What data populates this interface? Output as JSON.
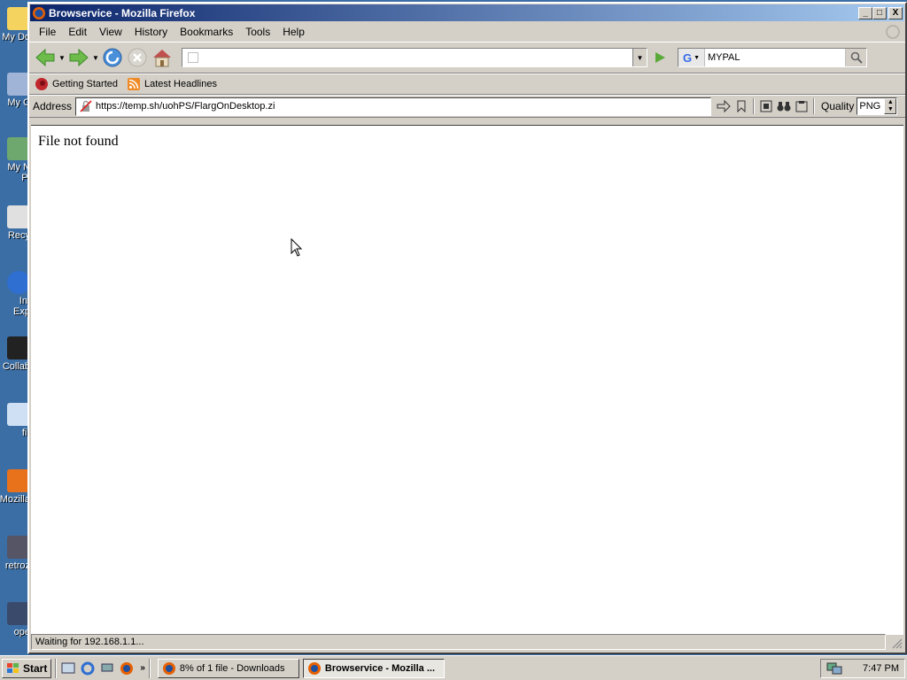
{
  "desktop": {
    "icons": [
      {
        "label": "My Do",
        "name": "my-documents"
      },
      {
        "label": "My C",
        "name": "my-computer"
      },
      {
        "label": "My N\nPl",
        "name": "my-network-places"
      },
      {
        "label": "Recy",
        "name": "recycle-bin"
      },
      {
        "label": "Int\nExp",
        "name": "internet-explorer"
      },
      {
        "label": "Collab",
        "name": "collab"
      },
      {
        "label": "fir",
        "name": "firefox-shortcut"
      },
      {
        "label": "Mozilla",
        "name": "mozilla"
      },
      {
        "label": "retroz",
        "name": "retroz"
      },
      {
        "label": "ope",
        "name": "opera"
      }
    ]
  },
  "window": {
    "title": "Browservice - Mozilla Firefox",
    "controls": {
      "minimize": "_",
      "maximize": "□",
      "close": "X"
    }
  },
  "menu": {
    "file": "File",
    "edit": "Edit",
    "view": "View",
    "history": "History",
    "bookmarks": "Bookmarks",
    "tools": "Tools",
    "help": "Help"
  },
  "navbar": {
    "url_value": "",
    "search_value": "MYPAL",
    "search_engine": "G"
  },
  "bookmarks_bar": {
    "items": [
      {
        "label": "Getting Started",
        "icon": "firefox-bookmark-icon"
      },
      {
        "label": "Latest Headlines",
        "icon": "rss-feed-icon"
      }
    ]
  },
  "browservice": {
    "address_label": "Address",
    "address_value": "https://temp.sh/uohPS/FlargOnDesktop.zi",
    "quality_label": "Quality",
    "quality_value": "PNG"
  },
  "content": {
    "message": "File not found"
  },
  "status": {
    "text": "Waiting for 192.168.1.1..."
  },
  "taskbar": {
    "start_label": "Start",
    "more_arrows": "»",
    "tasks": [
      {
        "label": "8% of 1 file - Downloads",
        "active": false
      },
      {
        "label": "Browservice - Mozilla ...",
        "active": true
      }
    ],
    "clock": "7:47 PM"
  },
  "colors": {
    "desktop": "#3a6ea5",
    "titlebar_start": "#0a246a",
    "titlebar_end": "#a6caf0",
    "chrome": "#d4d0c8"
  }
}
